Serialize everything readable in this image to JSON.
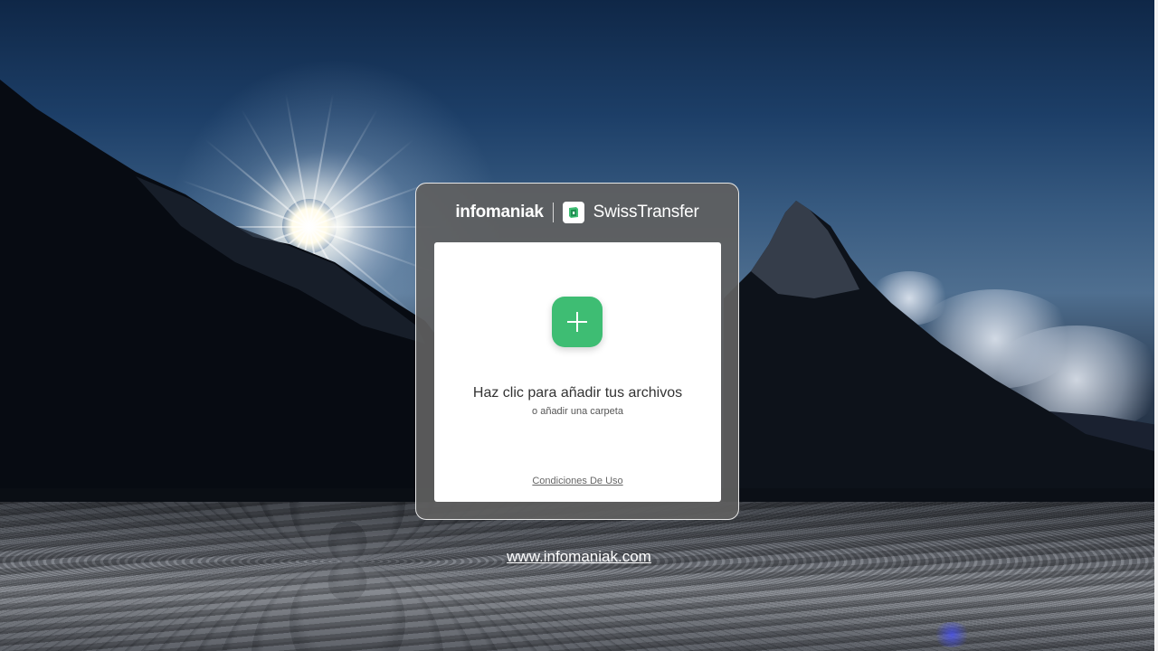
{
  "header": {
    "brand_primary": "infomaniak",
    "brand_secondary": "SwissTransfer"
  },
  "dropzone": {
    "title": "Haz clic para añadir tus archivos",
    "subtitle": "o añadir una carpeta",
    "terms_link": "Condiciones De Uso"
  },
  "footer": {
    "website_link": "www.infomaniak.com"
  },
  "icons": {
    "add": "plus-icon",
    "logo": "swisstransfer-logo-icon"
  },
  "colors": {
    "accent_green": "#3ebd73",
    "card_bg": "#5f5f5f",
    "dropzone_bg": "#ffffff"
  }
}
